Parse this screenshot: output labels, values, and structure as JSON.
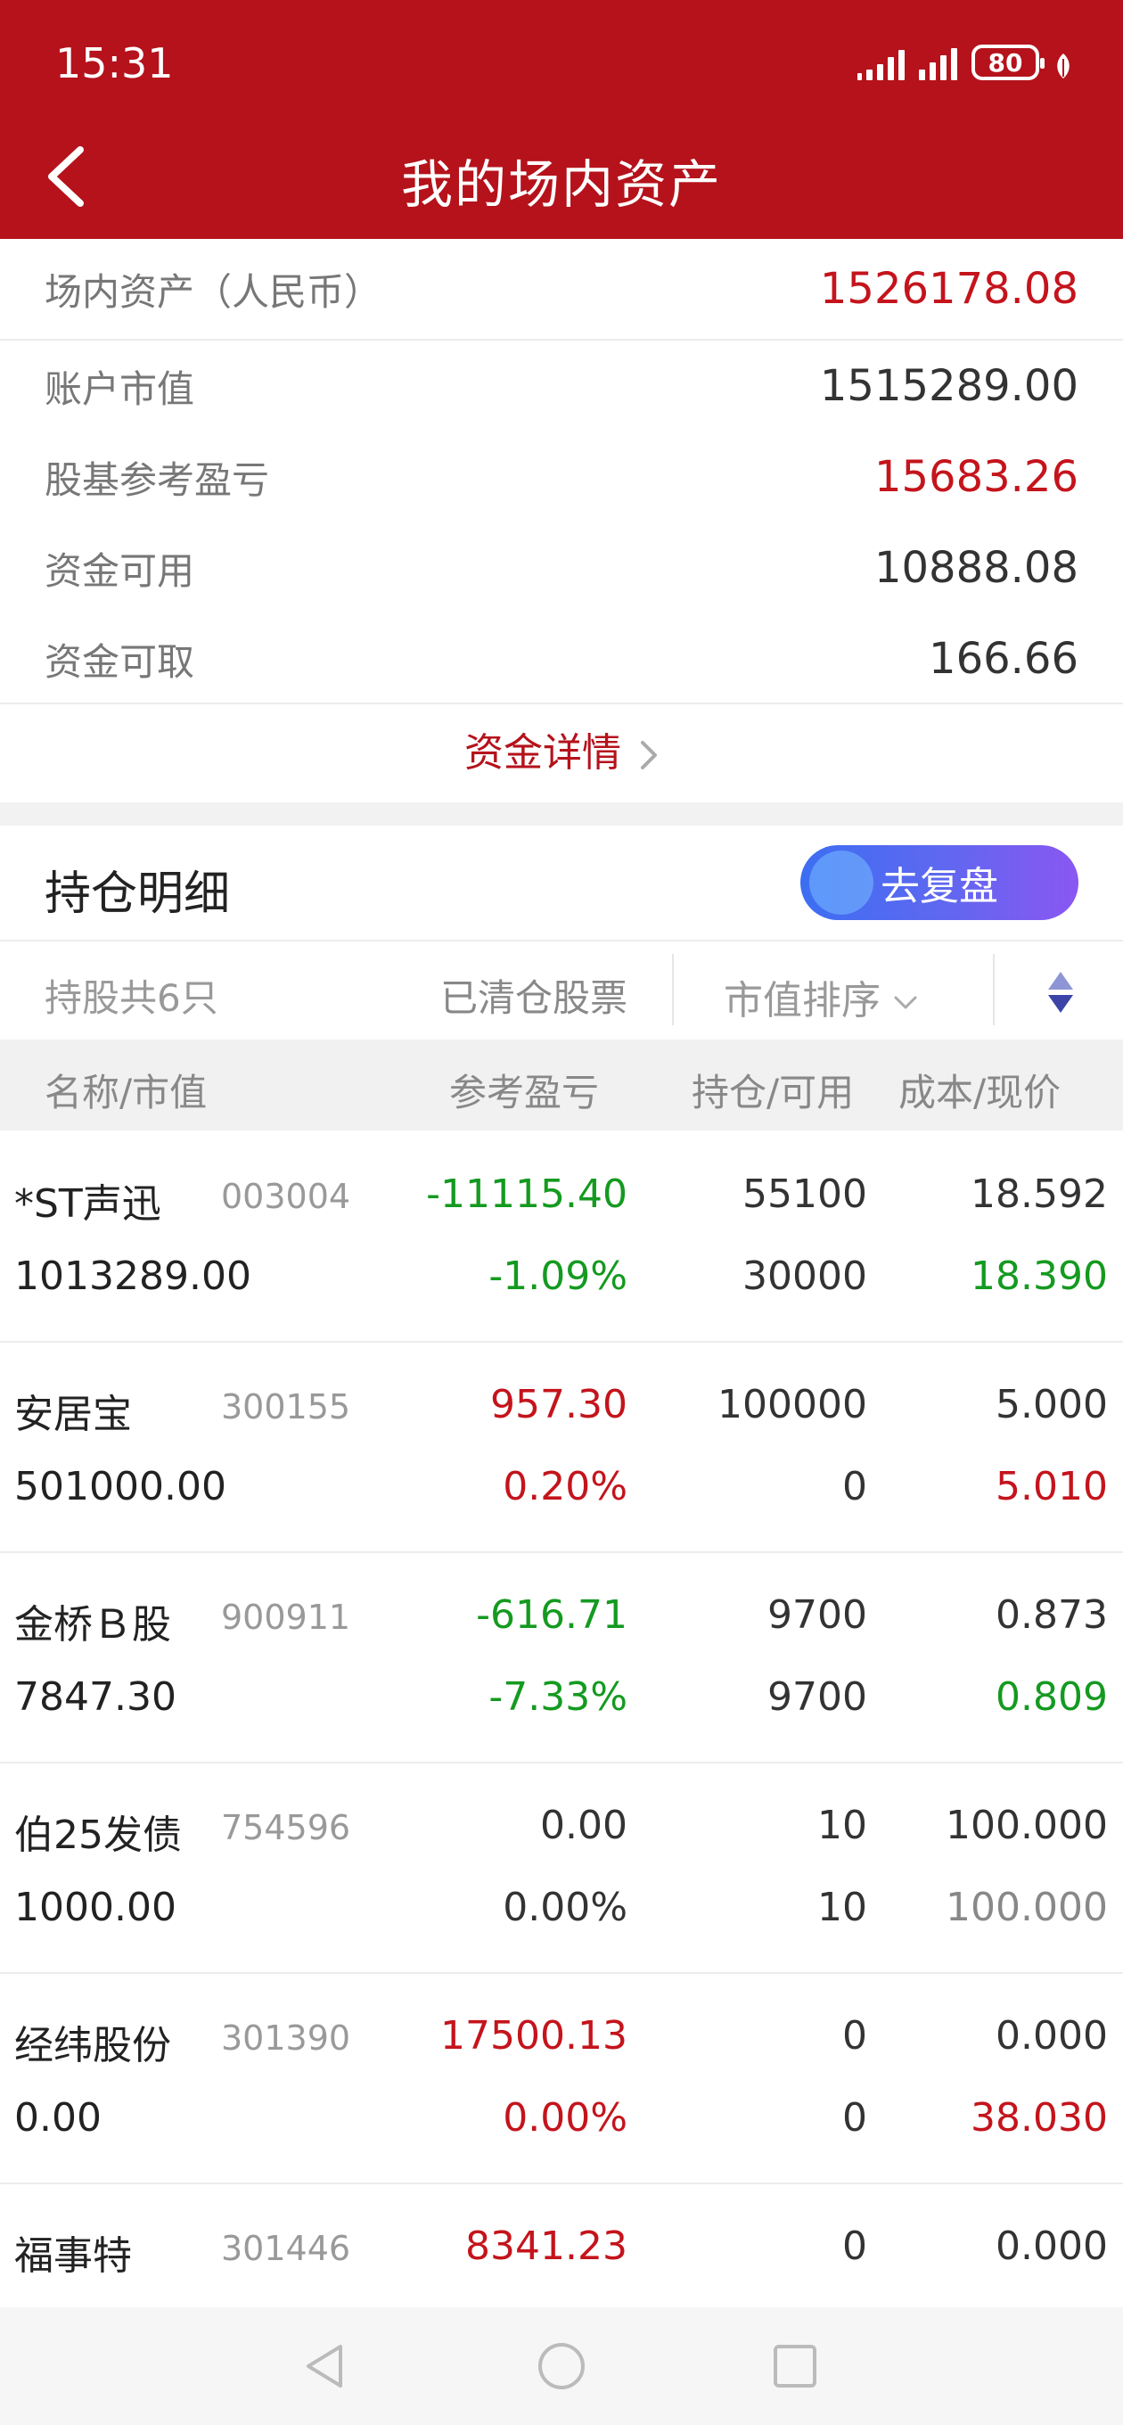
{
  "status": {
    "time": "15:31",
    "battery": "80"
  },
  "header": {
    "title": "我的场内资产"
  },
  "assets": {
    "total_label": "场内资产（人民币）",
    "total_value": "1526178.08",
    "market_value_label": "账户市值",
    "market_value": "1515289.00",
    "pl_label": "股基参考盈亏",
    "pl_value": "15683.26",
    "available_label": "资金可用",
    "available_value": "10888.08",
    "withdrawable_label": "资金可取",
    "withdrawable_value": "166.66",
    "detail_link": "资金详情"
  },
  "positions": {
    "title": "持仓明细",
    "review_button": "去复盘",
    "count_text": "持股共6只",
    "cleared_link": "已清仓股票",
    "sort_label": "市值排序",
    "columns": {
      "name": "名称/市值",
      "pl": "参考盈亏",
      "hold": "持仓/可用",
      "cost": "成本/现价"
    },
    "rows": [
      {
        "name": "*ST声迅",
        "code": "003004",
        "market_value": "1013289.00",
        "pl": "-11115.40",
        "pl_pct": "-1.09%",
        "hold": "55100",
        "avail": "30000",
        "cost": "18.592",
        "price": "18.390"
      },
      {
        "name": "安居宝",
        "code": "300155",
        "market_value": "501000.00",
        "pl": "957.30",
        "pl_pct": "0.20%",
        "hold": "100000",
        "avail": "0",
        "cost": "5.000",
        "price": "5.010"
      },
      {
        "name": "金桥Ｂ股",
        "code": "900911",
        "market_value": "7847.30",
        "pl": "-616.71",
        "pl_pct": "-7.33%",
        "hold": "9700",
        "avail": "9700",
        "cost": "0.873",
        "price": "0.809"
      },
      {
        "name": "伯25发债",
        "code": "754596",
        "market_value": "1000.00",
        "pl": "0.00",
        "pl_pct": "0.00%",
        "hold": "10",
        "avail": "10",
        "cost": "100.000",
        "price": "100.000"
      },
      {
        "name": "经纬股份",
        "code": "301390",
        "market_value": "0.00",
        "pl": "17500.13",
        "pl_pct": "0.00%",
        "hold": "0",
        "avail": "0",
        "cost": "0.000",
        "price": "38.030"
      },
      {
        "name": "福事特",
        "code": "301446",
        "market_value": "",
        "pl": "8341.23",
        "pl_pct": "",
        "hold": "0",
        "avail": "",
        "cost": "0.000",
        "price": ""
      }
    ]
  },
  "colors": {
    "brand_red": "#b5121b",
    "up_red": "#c4141c",
    "down_green": "#149a20"
  },
  "icons": [
    "back-arrow-icon",
    "signal-icon",
    "battery-icon",
    "leaf-icon",
    "chevron-right-icon",
    "chevron-down-icon",
    "sort-toggle-icon",
    "nav-back-icon",
    "nav-home-icon",
    "nav-recents-icon"
  ]
}
